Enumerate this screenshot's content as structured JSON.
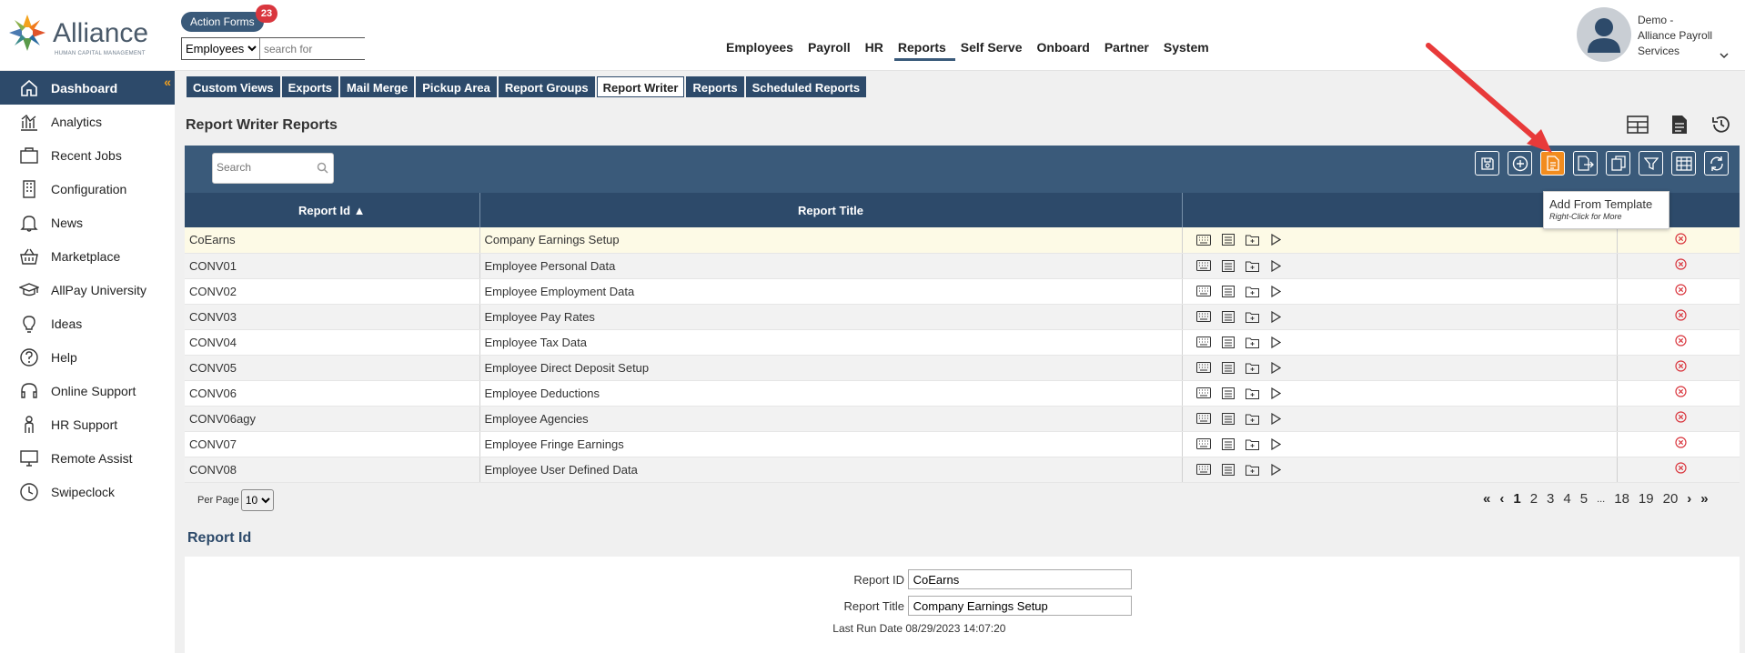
{
  "header": {
    "logo_text": "Alliance",
    "logo_sub": "HUMAN CAPITAL MANAGEMENT",
    "action_forms_label": "Action Forms",
    "action_forms_count": "23",
    "search_scope": "Employees",
    "search_placeholder": "search for",
    "nav": [
      "Employees",
      "Payroll",
      "HR",
      "Reports",
      "Self Serve",
      "Onboard",
      "Partner",
      "System"
    ],
    "nav_active": "Reports",
    "user_line1": "Demo -",
    "user_line2": "Alliance Payroll",
    "user_line3": "Services"
  },
  "sidebar": {
    "items": [
      {
        "label": "Dashboard",
        "icon": "home-icon",
        "active": true
      },
      {
        "label": "Analytics",
        "icon": "analytics-icon"
      },
      {
        "label": "Recent Jobs",
        "icon": "briefcase-icon"
      },
      {
        "label": "Configuration",
        "icon": "building-icon"
      },
      {
        "label": "News",
        "icon": "bell-icon"
      },
      {
        "label": "Marketplace",
        "icon": "basket-icon"
      },
      {
        "label": "AllPay University",
        "icon": "graduation-cap-icon"
      },
      {
        "label": "Ideas",
        "icon": "lightbulb-icon"
      },
      {
        "label": "Help",
        "icon": "question-icon"
      },
      {
        "label": "Online Support",
        "icon": "headset-icon"
      },
      {
        "label": "HR Support",
        "icon": "person-icon"
      },
      {
        "label": "Remote Assist",
        "icon": "monitor-icon"
      },
      {
        "label": "Swipeclock",
        "icon": "clock-icon"
      }
    ]
  },
  "tabs": [
    "Custom Views",
    "Exports",
    "Mail Merge",
    "Pickup Area",
    "Report Groups",
    "Report Writer",
    "Reports",
    "Scheduled Reports"
  ],
  "tabs_active": "Report Writer",
  "page_title": "Report Writer Reports",
  "grid": {
    "search_placeholder": "Search",
    "columns": [
      "Report Id ▲",
      "Report Title",
      "",
      ""
    ],
    "rows": [
      {
        "id": "CoEarns",
        "title": "Company Earnings Setup"
      },
      {
        "id": "CONV01",
        "title": "Employee Personal Data"
      },
      {
        "id": "CONV02",
        "title": "Employee Employment Data"
      },
      {
        "id": "CONV03",
        "title": "Employee Pay Rates"
      },
      {
        "id": "CONV04",
        "title": "Employee Tax Data"
      },
      {
        "id": "CONV05",
        "title": "Employee Direct Deposit Setup"
      },
      {
        "id": "CONV06",
        "title": "Employee Deductions"
      },
      {
        "id": "CONV06agy",
        "title": "Employee Agencies"
      },
      {
        "id": "CONV07",
        "title": "Employee Fringe Earnings"
      },
      {
        "id": "CONV08",
        "title": "Employee User Defined Data"
      }
    ],
    "tooltip_title": "Add From Template",
    "tooltip_sub": "Right-Click for More"
  },
  "pager": {
    "per_page_label": "Per Page",
    "per_page_value": "10",
    "pages": [
      "1",
      "2",
      "3",
      "4",
      "5",
      "...",
      "18",
      "19",
      "20"
    ],
    "current": "1"
  },
  "detail": {
    "section_title": "Report Id",
    "report_id_label": "Report ID",
    "report_id_value": "CoEarns",
    "report_title_label": "Report Title",
    "report_title_value": "Company Earnings Setup",
    "last_run_label": "Last Run Date",
    "last_run_value": "08/29/2023 14:07:20"
  },
  "colors": {
    "navy": "#2d4a6a",
    "toolbar": "#3a5a7a",
    "highlight": "#f28c1e",
    "arrow": "#e83a3a",
    "delete": "#d9363e"
  }
}
